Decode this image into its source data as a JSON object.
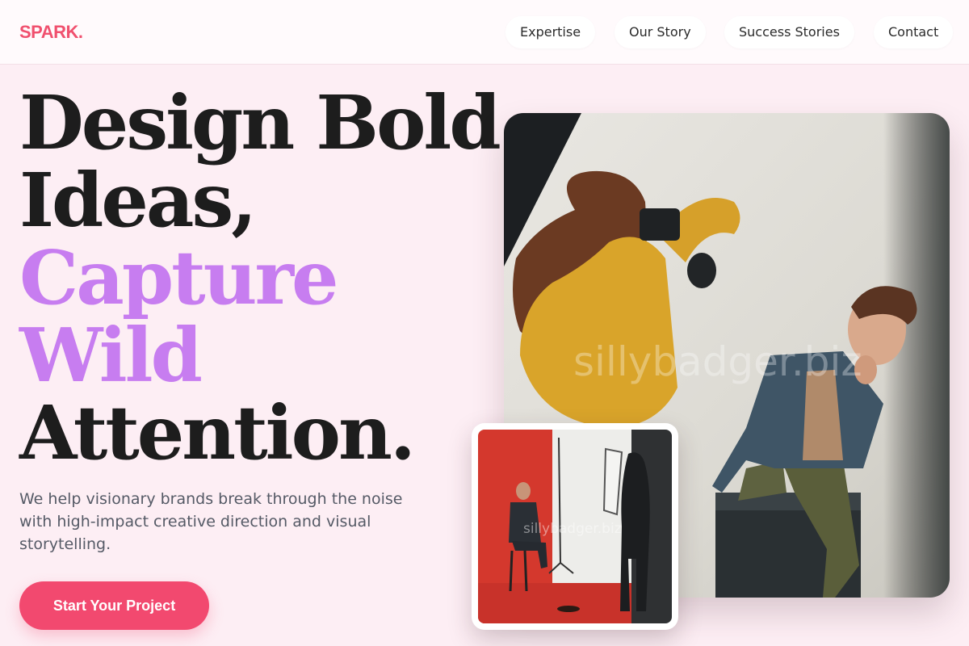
{
  "header": {
    "logo": "SPARK.",
    "nav": [
      "Expertise",
      "Our Story",
      "Success Stories",
      "Contact"
    ]
  },
  "hero": {
    "headline_lines": [
      "Design Bold",
      "Ideas,",
      "Capture",
      "Wild",
      "Attention."
    ],
    "accent_lines": [
      2,
      3
    ],
    "subtitle": "We help visionary brands break through the noise with high-impact creative direction and visual storytelling.",
    "cta": "Start Your Project"
  },
  "images": {
    "main_watermark": "sillybadger.biz",
    "small_watermark": "sillybadger.biz"
  },
  "colors": {
    "brand": "#f0506e",
    "accent": "#c77df0",
    "background": "#fdeef4",
    "cta": "#f2496f"
  }
}
